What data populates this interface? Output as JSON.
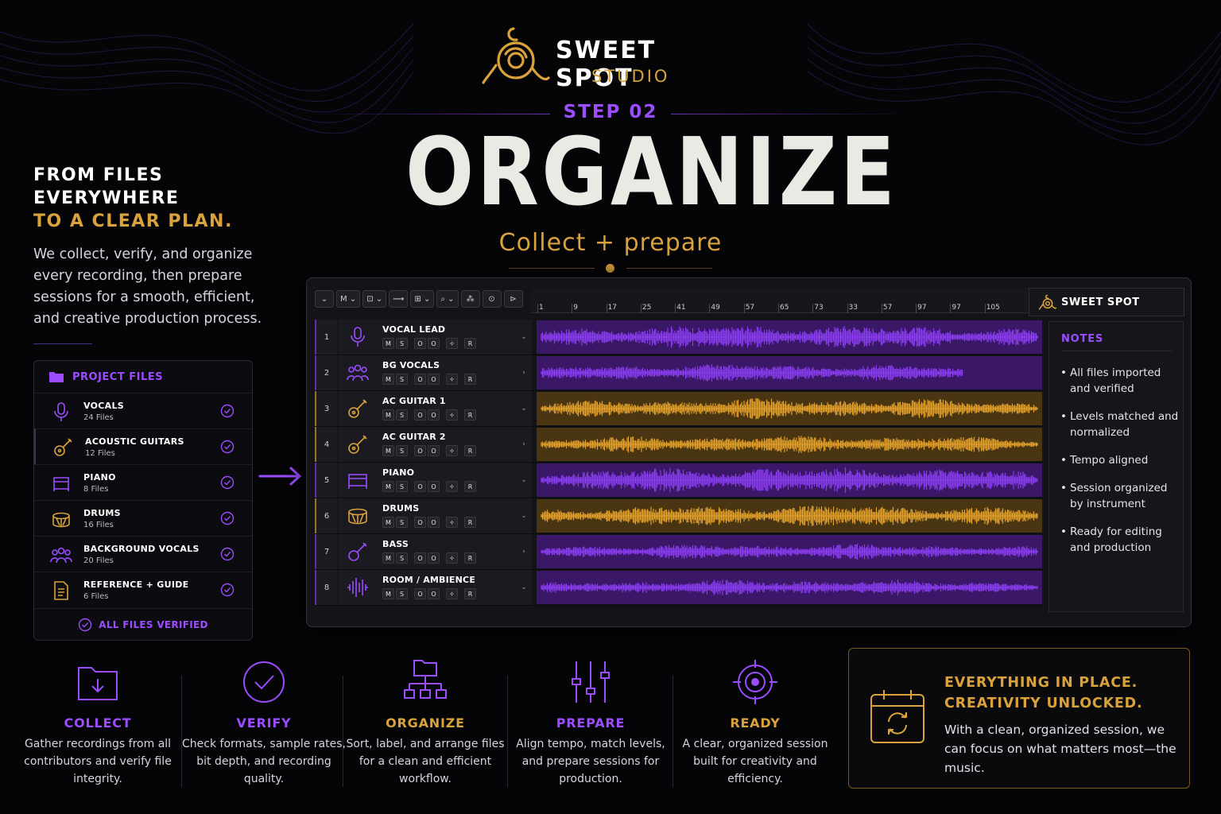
{
  "brand": {
    "title": "SWEET SPOT",
    "sub": "STUDIO",
    "gold": "#d9a23a",
    "purple": "#9b4dff"
  },
  "step": {
    "label": "STEP 02",
    "title": "ORGANIZE",
    "subtitle": "Collect + prepare"
  },
  "intro": {
    "line1": "FROM FILES",
    "line2": "EVERYWHERE",
    "line3": "TO A CLEAR PLAN.",
    "body": "We collect, verify, and organize every recording, then prepare sessions for a smooth, efficient, and creative production process."
  },
  "project_files": {
    "title": "PROJECT FILES",
    "items": [
      {
        "name": "VOCALS",
        "count": "24 Files",
        "icon": "microphone-icon"
      },
      {
        "name": "ACOUSTIC GUITARS",
        "count": "12 Files",
        "icon": "guitar-icon"
      },
      {
        "name": "PIANO",
        "count": "8 Files",
        "icon": "piano-icon"
      },
      {
        "name": "DRUMS",
        "count": "16 Files",
        "icon": "drum-icon"
      },
      {
        "name": "BACKGROUND VOCALS",
        "count": "20 Files",
        "icon": "group-icon"
      },
      {
        "name": "REFERENCE + GUIDE",
        "count": "6 Files",
        "icon": "document-icon"
      }
    ],
    "footer": "ALL FILES VERIFIED"
  },
  "daw": {
    "toolbar": [
      "⌄",
      "M ⌄",
      "⊡ ⌄",
      "⟿",
      "⊞ ⌄",
      "⌕ ⌄",
      "⁂",
      "⊙",
      "⊳"
    ],
    "ruler": [
      "1",
      "9",
      "17",
      "25",
      "41",
      "49",
      "57",
      "65",
      "73",
      "33",
      "57",
      "97",
      "97",
      "105"
    ],
    "brand_label": "SWEET SPOT",
    "ctrl_labels": {
      "mute": "M",
      "solo": "S",
      "a": "O",
      "b": "O",
      "c": "✧",
      "rec": "R"
    },
    "tracks": [
      {
        "num": "1",
        "name": "VOCAL LEAD",
        "color": "purple",
        "icon": "microphone-icon",
        "chev": "⌄",
        "wave": {
          "start": 0.0,
          "end": 1.0,
          "amp": 0.55
        }
      },
      {
        "num": "2",
        "name": "BG VOCALS",
        "color": "purple",
        "icon": "group-icon",
        "chev": "›",
        "wave": {
          "start": 0.0,
          "end": 0.85,
          "amp": 0.42
        }
      },
      {
        "num": "3",
        "name": "AC GUITAR 1",
        "color": "gold",
        "icon": "guitar-icon",
        "chev": "⌄",
        "wave": {
          "start": 0.0,
          "end": 1.0,
          "amp": 0.45
        }
      },
      {
        "num": "4",
        "name": "AC GUITAR 2",
        "color": "gold",
        "icon": "guitar-icon",
        "chev": "›",
        "wave": {
          "start": 0.0,
          "end": 1.0,
          "amp": 0.4
        }
      },
      {
        "num": "5",
        "name": "PIANO",
        "color": "purple",
        "icon": "piano-icon",
        "chev": "⌄",
        "wave": {
          "start": 0.0,
          "end": 1.0,
          "amp": 0.6
        }
      },
      {
        "num": "6",
        "name": "DRUMS",
        "color": "gold",
        "icon": "drum-icon",
        "chev": "⌄",
        "wave": {
          "start": 0.0,
          "end": 1.0,
          "amp": 0.5
        }
      },
      {
        "num": "7",
        "name": "BASS",
        "color": "purple",
        "icon": "bass-guitar-icon",
        "chev": "›",
        "wave": {
          "start": 0.0,
          "end": 1.0,
          "amp": 0.35
        }
      },
      {
        "num": "8",
        "name": "ROOM / AMBIENCE",
        "color": "purple",
        "icon": "waveform-icon",
        "chev": "⌄",
        "wave": {
          "start": 0.0,
          "end": 1.0,
          "amp": 0.35
        }
      }
    ],
    "notes": {
      "title": "NOTES",
      "items": [
        "All files imported and verified",
        "Levels matched and normalized",
        "Tempo aligned",
        "Session organized by instrument",
        "Ready for editing and production"
      ]
    }
  },
  "steps": [
    {
      "title": "COLLECT",
      "color": "purple",
      "icon": "folder-download-icon",
      "desc": "Gather recordings from all contributors and verify file integrity."
    },
    {
      "title": "VERIFY",
      "color": "purple",
      "icon": "check-circle-icon",
      "desc": "Check formats, sample rates, bit depth, and recording quality."
    },
    {
      "title": "ORGANIZE",
      "color": "gold",
      "icon": "folder-tree-icon",
      "desc": "Sort, label, and arrange files for a clean and efficient workflow."
    },
    {
      "title": "PREPARE",
      "color": "purple",
      "icon": "sliders-icon",
      "desc": "Align tempo, match levels, and prepare sessions for production."
    },
    {
      "title": "READY",
      "color": "gold",
      "icon": "target-icon",
      "desc": "A clear, organized session built for creativity and efficiency."
    }
  ],
  "callout": {
    "line1": "EVERYTHING IN PLACE.",
    "line2": "CREATIVITY UNLOCKED.",
    "body": "With a clean, organized session, we can focus on what matters most—the music."
  }
}
